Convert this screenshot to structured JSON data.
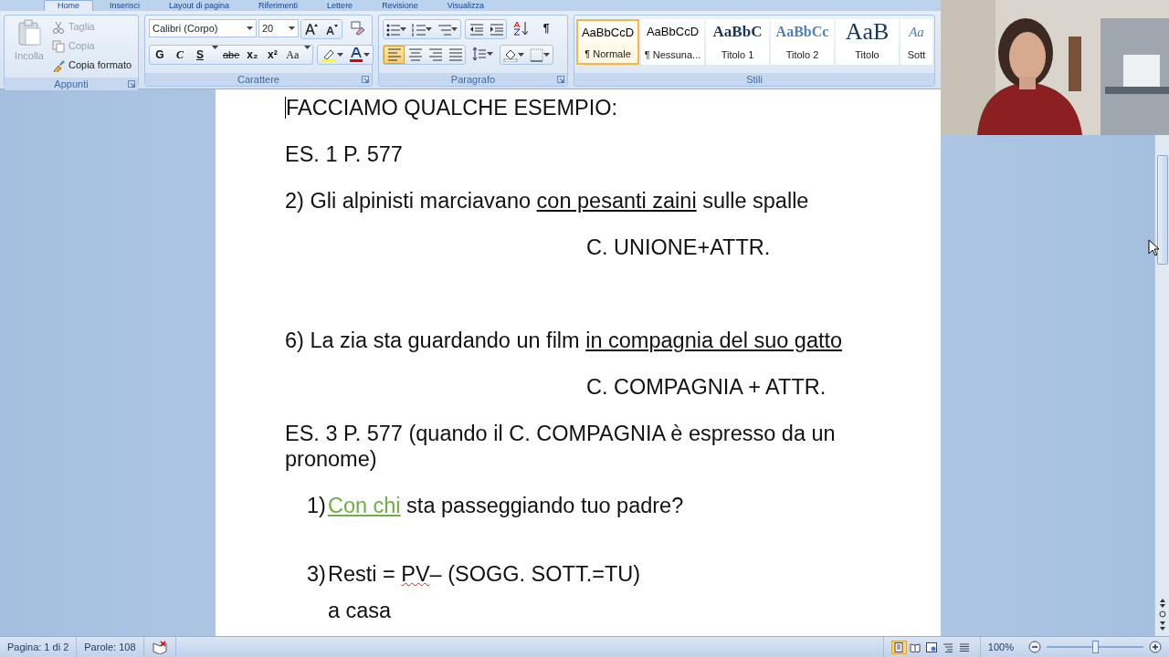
{
  "tabs": [
    {
      "label": "Home",
      "selected": true
    },
    {
      "label": "Inserisci",
      "selected": false
    },
    {
      "label": "Layout di pagina",
      "selected": false
    },
    {
      "label": "Riferimenti",
      "selected": false
    },
    {
      "label": "Lettere",
      "selected": false
    },
    {
      "label": "Revisione",
      "selected": false
    },
    {
      "label": "Visualizza",
      "selected": false
    }
  ],
  "clipboard": {
    "paste": {
      "label": "Incolla",
      "disabled": true
    },
    "items": [
      {
        "kind": "cut",
        "label": "Taglia",
        "disabled": true
      },
      {
        "kind": "copy",
        "label": "Copia",
        "disabled": true
      },
      {
        "kind": "format_painter",
        "label": "Copia formato",
        "disabled": false
      }
    ],
    "group_label": "Appunti"
  },
  "font": {
    "name": "Calibri (Corpo)",
    "size": "20",
    "format_buttons": [
      {
        "kind": "bold",
        "label": "G"
      },
      {
        "kind": "italic",
        "label": "C"
      },
      {
        "kind": "underline",
        "label": "S"
      },
      {
        "kind": "strike",
        "label": "abe"
      },
      {
        "kind": "sub",
        "label": "x₂"
      },
      {
        "kind": "sup",
        "label": "x²"
      },
      {
        "kind": "case",
        "label": "Aa"
      }
    ],
    "group_label": "Carattere"
  },
  "paragraph": {
    "show_marks": "¶",
    "align_buttons": [
      {
        "kind": "left",
        "selected": true
      },
      {
        "kind": "center",
        "selected": false
      },
      {
        "kind": "right",
        "selected": false
      },
      {
        "kind": "justify",
        "selected": false
      }
    ],
    "group_label": "Paragrafo"
  },
  "styles": {
    "items": [
      {
        "kind": "normal",
        "preview": "AaBbCcD",
        "label": "¶ Normale",
        "selected": true
      },
      {
        "kind": "normal",
        "preview": "AaBbCcD",
        "label": "¶ Nessuna...",
        "selected": false
      },
      {
        "kind": "heading1",
        "preview": "AaBbC",
        "label": "Titolo 1",
        "selected": false
      },
      {
        "kind": "heading2",
        "preview": "AaBbCc",
        "label": "Titolo 2",
        "selected": false
      },
      {
        "kind": "title",
        "preview": "AaB",
        "label": "Titolo",
        "selected": false
      },
      {
        "kind": "subtitle",
        "preview": "Aa",
        "label": "Sott",
        "selected": false
      }
    ],
    "group_label": "Stili"
  },
  "document": {
    "paragraphs": [
      {
        "kind": "plain",
        "segments": [
          {
            "text": "FACCIAMO QUALCHE ESEMPIO:"
          }
        ]
      },
      {
        "kind": "plain",
        "segments": [
          {
            "text": "ES. 1 P. 577"
          }
        ]
      },
      {
        "kind": "plain",
        "segments": [
          {
            "text": "2) Gli alpinisti marciavano "
          },
          {
            "text": "con pesanti zaini",
            "underline": true
          },
          {
            "text": " sulle spalle"
          }
        ]
      },
      {
        "kind": "indented",
        "segments": [
          {
            "text": "C. UNIONE+ATTR."
          }
        ]
      },
      {
        "kind": "blank"
      },
      {
        "kind": "plain",
        "segments": [
          {
            "text": "6) La zia sta guardando un film "
          },
          {
            "text": "in compagnia del suo gatto",
            "underline": true
          }
        ]
      },
      {
        "kind": "indented",
        "segments": [
          {
            "text": "C. COMPAGNIA + ATTR."
          }
        ]
      },
      {
        "kind": "plain",
        "segments": [
          {
            "text": "ES. 3 P. 577 (quando il C. COMPAGNIA è espresso da un pronome)"
          }
        ]
      },
      {
        "kind": "numbered",
        "number": "1)",
        "lines": [
          [
            {
              "text": "Con chi",
              "underline": true,
              "color": "#70ad47"
            },
            {
              "text": " sta passeggiando tuo padre?"
            }
          ]
        ]
      },
      {
        "kind": "numbered",
        "number": "3)",
        "lines": [
          [
            {
              "text": "Resti = "
            },
            {
              "text": "PV",
              "spelling_error": true
            },
            {
              "text": "– (SOGG. SOTT.=TU)"
            }
          ],
          [
            {
              "text": "a casa"
            }
          ]
        ]
      }
    ]
  },
  "status_bar": {
    "page": "Pagina: 1 di 2",
    "words": "Parole: 108",
    "views": [
      {
        "kind": "print",
        "selected": true
      },
      {
        "kind": "reading",
        "selected": false
      },
      {
        "kind": "web",
        "selected": false
      },
      {
        "kind": "outline",
        "selected": false
      },
      {
        "kind": "draft",
        "selected": false
      }
    ],
    "zoom": "100%",
    "zoom_level": {
      "level": 0.5
    }
  }
}
